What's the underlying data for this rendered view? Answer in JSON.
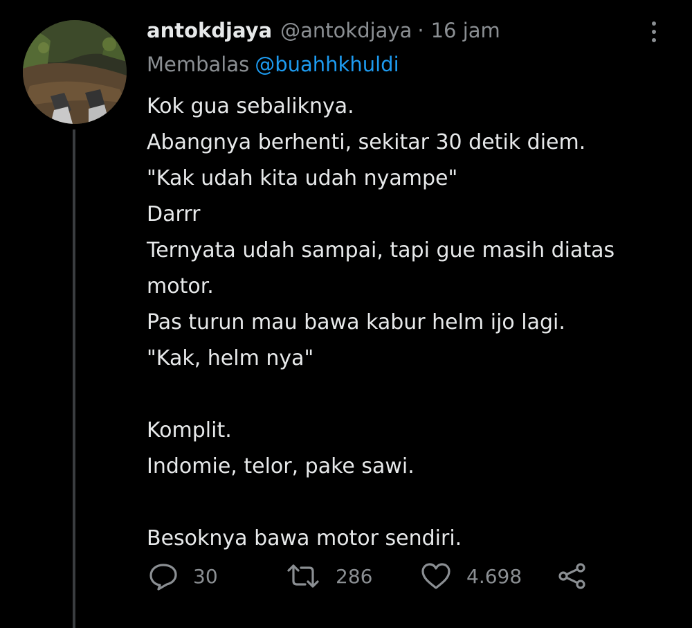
{
  "tweet": {
    "display_name": "antokdjaya",
    "handle": "@antokdjaya",
    "separator": "·",
    "time": "16 jam",
    "replying_label": "Membalas",
    "replying_to": "@buahhkhuldi",
    "lines": [
      "Kok gua sebaliknya.",
      "Abangnya berhenti, sekitar 30 detik diem.",
      "\"Kak udah kita udah nyampe\"",
      "Darrr",
      "Ternyata udah sampai, tapi gue masih diatas",
      "motor.",
      "Pas turun mau bawa kabur helm ijo lagi.",
      "\"Kak, helm nya\"",
      "",
      "Komplit.",
      "Indomie, telor, pake sawi.",
      "",
      "Besoknya bawa motor sendiri."
    ],
    "stats": {
      "replies": "30",
      "retweets": "286",
      "likes": "4.698"
    }
  },
  "icons": {
    "reply": "reply-icon",
    "retweet": "retweet-icon",
    "like": "heart-icon",
    "share": "share-icon",
    "more": "more-options-icon"
  },
  "colors": {
    "background": "#000000",
    "text": "#e7e9ea",
    "muted": "#8b8f93",
    "link": "#1d9bf0",
    "thread_line": "#3a3d40"
  }
}
